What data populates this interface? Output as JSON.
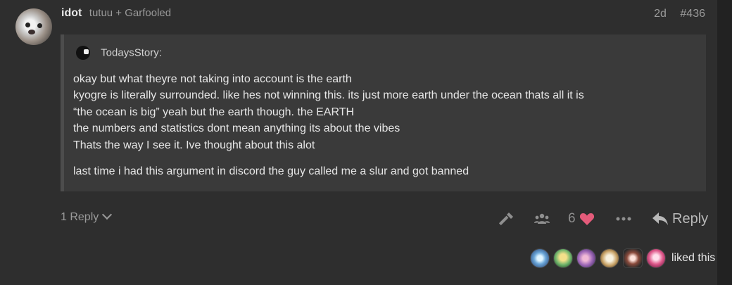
{
  "post": {
    "username": "idot",
    "full_name": "tutuu + Garfooled",
    "age": "2d",
    "post_number": "#436",
    "avatar_icon": "dog-avatar"
  },
  "quote": {
    "author": "TodaysStory:",
    "lines": [
      "okay but what theyre not taking into account is the earth",
      "kyogre is literally surrounded. like hes not winning this. its just more earth under the ocean thats all it is",
      "“the ocean is big” yeah but the earth though. the EARTH",
      "the numbers and statistics dont mean anything its about the vibes",
      "Thats the way I see it. Ive thought about this alot"
    ],
    "last_paragraph": "last time i had this argument in discord the guy called me a slur and got banned"
  },
  "footer": {
    "replies_label": "1 Reply",
    "likes_count": "6",
    "reply_label": "Reply",
    "liked_text": "liked this",
    "heart_color": "#e45b7a"
  }
}
